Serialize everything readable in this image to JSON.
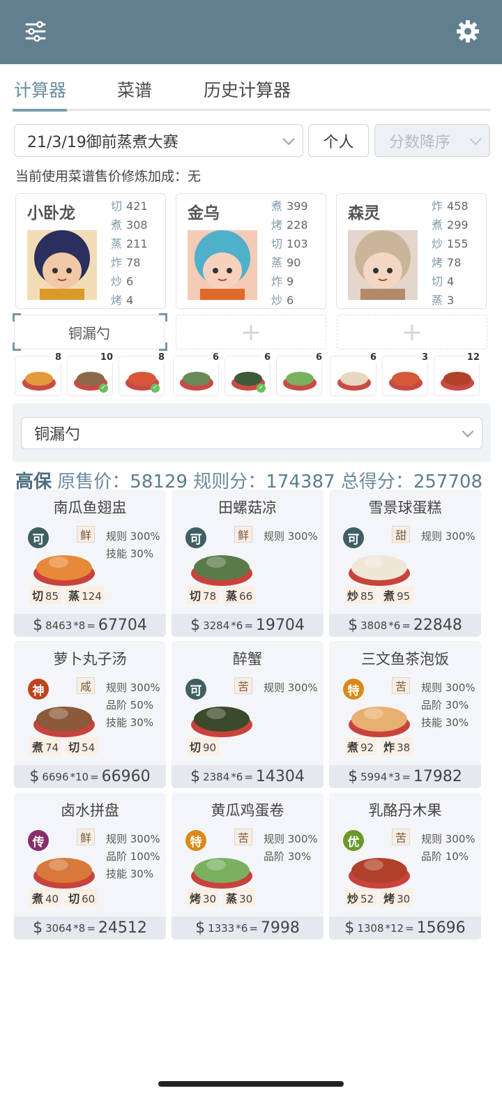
{
  "tabs": [
    "计算器",
    "菜谱",
    "历史计算器"
  ],
  "contest": {
    "value": "21/3/19御前蒸煮大赛"
  },
  "mode_button": "个人",
  "sort": {
    "value": "分数降序"
  },
  "note": "当前使用菜谱售价修炼加成：无",
  "chefs": [
    {
      "name": "小卧龙",
      "stats": [
        [
          "切",
          "421"
        ],
        [
          "煮",
          "308"
        ],
        [
          "蒸",
          "211"
        ],
        [
          "炸",
          "78"
        ],
        [
          "炒",
          "6"
        ],
        [
          "烤",
          "4"
        ]
      ]
    },
    {
      "name": "金乌",
      "stats": [
        [
          "煮",
          "399"
        ],
        [
          "烤",
          "228"
        ],
        [
          "切",
          "103"
        ],
        [
          "蒸",
          "90"
        ],
        [
          "炸",
          "9"
        ],
        [
          "炒",
          "6"
        ]
      ]
    },
    {
      "name": "森灵",
      "stats": [
        [
          "炸",
          "458"
        ],
        [
          "煮",
          "299"
        ],
        [
          "炒",
          "155"
        ],
        [
          "烤",
          "78"
        ],
        [
          "切",
          "4"
        ],
        [
          "蒸",
          "3"
        ]
      ]
    }
  ],
  "equipment": [
    "铜漏勺",
    "+",
    "+"
  ],
  "thumbs": [
    {
      "count": "8",
      "check": false
    },
    {
      "count": "10",
      "check": true
    },
    {
      "count": "8",
      "check": true
    },
    {
      "count": "6",
      "check": false
    },
    {
      "count": "6",
      "check": true
    },
    {
      "count": "6",
      "check": false
    },
    {
      "count": "6",
      "check": false
    },
    {
      "count": "3",
      "check": false
    },
    {
      "count": "12",
      "check": false
    }
  ],
  "equip_select": {
    "value": "铜漏勺"
  },
  "summary": {
    "tag": "高保",
    "orig_label": "原售价：",
    "orig": "58129",
    "rule_label": "规则分：",
    "rule": "174387",
    "total_label": "总得分：",
    "total": "257708"
  },
  "recipes": [
    {
      "name": "南瓜鱼翅盅",
      "rarity": "可",
      "flavor": "鲜",
      "bonus": [
        "规则 300%",
        "技能 30%"
      ],
      "skills": [
        [
          "切",
          "85"
        ],
        [
          "蒸",
          "124"
        ]
      ],
      "price": "8463",
      "qty": "*8",
      "total": "67704"
    },
    {
      "name": "田螺菇凉",
      "rarity": "可",
      "flavor": "鲜",
      "bonus": [
        "规则 300%"
      ],
      "skills": [
        [
          "切",
          "78"
        ],
        [
          "蒸",
          "66"
        ]
      ],
      "price": "3284",
      "qty": "*6",
      "total": "19704"
    },
    {
      "name": "雪景球蛋糕",
      "rarity": "可",
      "flavor": "甜",
      "bonus": [
        "规则 300%"
      ],
      "skills": [
        [
          "炒",
          "85"
        ],
        [
          "煮",
          "95"
        ]
      ],
      "price": "3808",
      "qty": "*6",
      "total": "22848"
    },
    {
      "name": "萝卜丸子汤",
      "rarity": "神",
      "flavor": "咸",
      "bonus": [
        "规则 300%",
        "品阶 50%",
        "技能 30%"
      ],
      "skills": [
        [
          "煮",
          "74"
        ],
        [
          "切",
          "54"
        ]
      ],
      "price": "6696",
      "qty": "*10",
      "total": "66960"
    },
    {
      "name": "醉蟹",
      "rarity": "可",
      "flavor": "苦",
      "bonus": [
        "规则 300%"
      ],
      "skills": [
        [
          "切",
          "90"
        ]
      ],
      "price": "2384",
      "qty": "*6",
      "total": "14304"
    },
    {
      "name": "三文鱼茶泡饭",
      "rarity": "特",
      "flavor": "苦",
      "bonus": [
        "规则 300%",
        "品阶 30%",
        "技能 30%"
      ],
      "skills": [
        [
          "煮",
          "92"
        ],
        [
          "炸",
          "38"
        ]
      ],
      "price": "5994",
      "qty": "*3",
      "total": "17982"
    },
    {
      "name": "卤水拼盘",
      "rarity": "传",
      "flavor": "鲜",
      "bonus": [
        "规则 300%",
        "品阶 100%",
        "技能 30%"
      ],
      "skills": [
        [
          "煮",
          "40"
        ],
        [
          "切",
          "60"
        ]
      ],
      "price": "3064",
      "qty": "*8",
      "total": "24512"
    },
    {
      "name": "黄瓜鸡蛋卷",
      "rarity": "特",
      "flavor": "苦",
      "bonus": [
        "规则 300%",
        "品阶 30%"
      ],
      "skills": [
        [
          "烤",
          "30"
        ],
        [
          "蒸",
          "30"
        ]
      ],
      "price": "1333",
      "qty": "*6",
      "total": "7998"
    },
    {
      "name": "乳酪丹木果",
      "rarity": "优",
      "flavor": "苦",
      "bonus": [
        "规则 300%",
        "品阶 10%"
      ],
      "skills": [
        [
          "炒",
          "52"
        ],
        [
          "烤",
          "30"
        ]
      ],
      "price": "1308",
      "qty": "*12",
      "total": "15696"
    }
  ],
  "colors": {
    "appbar": "#627f8f",
    "accent": "#6a8ea0",
    "rarity": {
      "可": "#3f5f63",
      "神": "#c2441e",
      "特": "#d98a1a",
      "传": "#8a2d6a",
      "优": "#6a9a2a"
    }
  },
  "icons": {
    "left": "sliders-icon",
    "right": "gear-icon"
  }
}
